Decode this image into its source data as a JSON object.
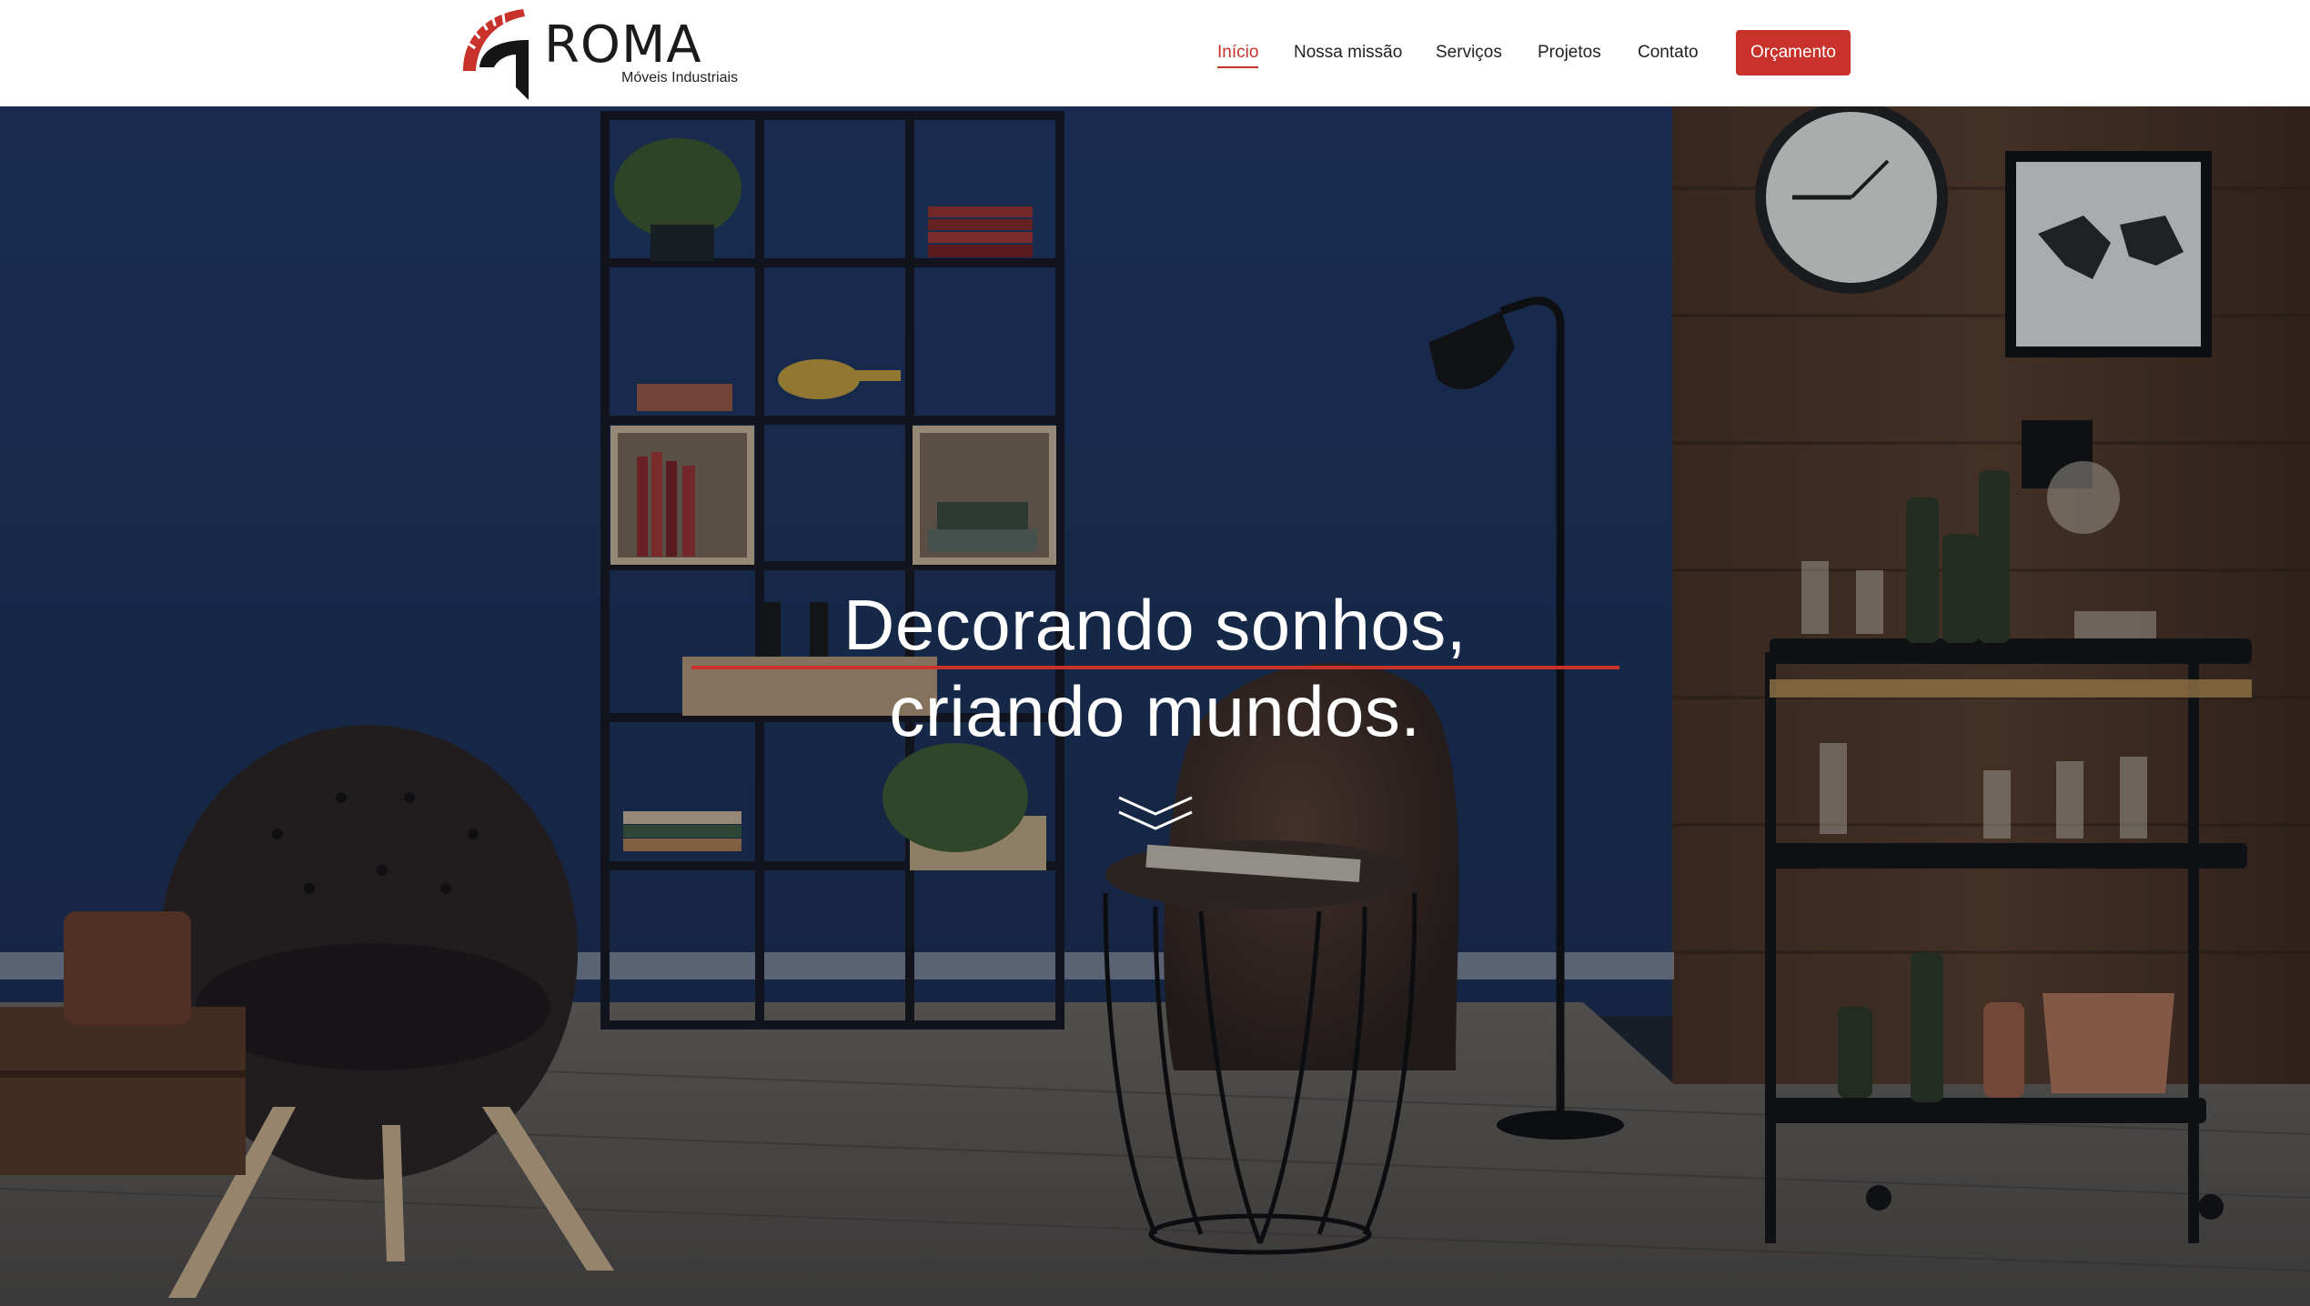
{
  "brand": {
    "name": "ROMA",
    "tagline": "Móveis Industriais",
    "logo_icon": "spartan-helmet-icon",
    "colors": {
      "primary": "#c8322b",
      "dark": "#1b1b1b"
    }
  },
  "nav": {
    "items": [
      {
        "label": "Início",
        "active": true
      },
      {
        "label": "Nossa missão",
        "active": false
      },
      {
        "label": "Serviços",
        "active": false
      },
      {
        "label": "Projetos",
        "active": false
      },
      {
        "label": "Contato",
        "active": false
      }
    ],
    "cta_label": "Orçamento"
  },
  "hero": {
    "headline_line1": "Decorando sonhos,",
    "headline_line2": "criando mundos.",
    "scroll_icon": "double-chevron-down-icon"
  }
}
